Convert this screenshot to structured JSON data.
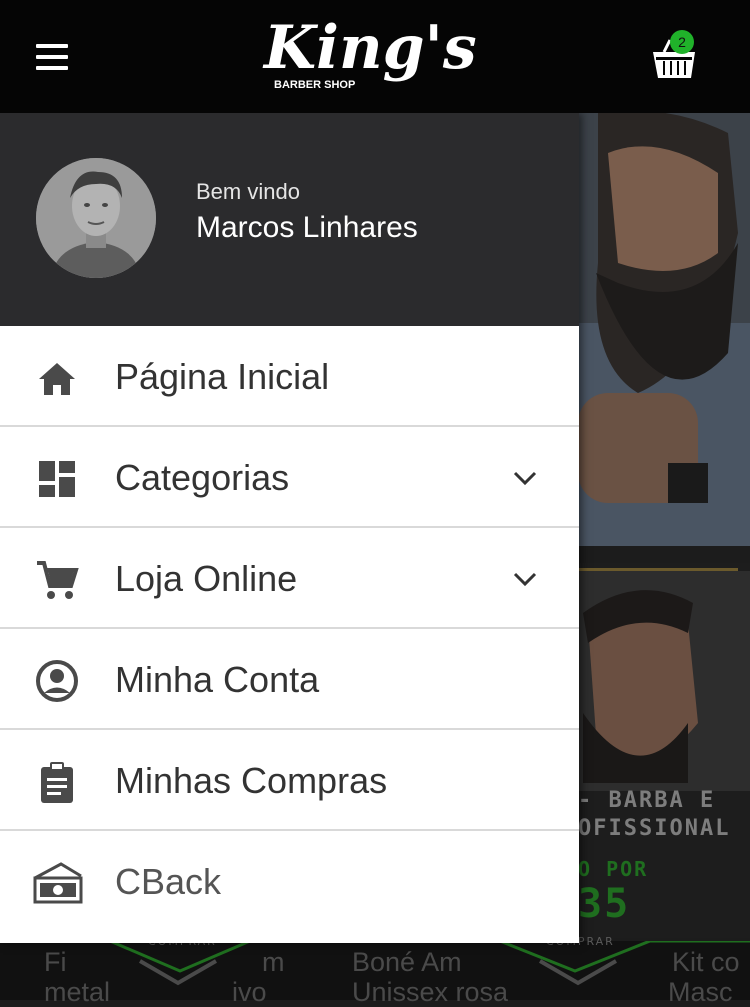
{
  "header": {
    "brand_script": "King's",
    "brand_sub": "BARBER SHOP",
    "cart_count": "2"
  },
  "drawer": {
    "greeting": "Bem vindo",
    "user_name": "Marcos Linhares",
    "items": [
      {
        "label": "Página Inicial",
        "icon": "home-icon",
        "expandable": false
      },
      {
        "label": "Categorias",
        "icon": "dashboard-icon",
        "expandable": true
      },
      {
        "label": "Loja Online",
        "icon": "shopping-cart-icon",
        "expandable": true
      },
      {
        "label": "Minha Conta",
        "icon": "account-circle-icon",
        "expandable": false
      },
      {
        "label": "Minhas Compras",
        "icon": "clipboard-icon",
        "expandable": false
      },
      {
        "label": "CBack",
        "icon": "cash-icon",
        "expandable": false
      }
    ]
  },
  "background": {
    "promo_line1": "- BARBA E",
    "promo_line2": "OFISSIONAL",
    "promo_price_label": "O POR",
    "promo_price": "35",
    "buy_label_1": "COMPRAR",
    "buy_label_2": "COMPRAR",
    "product_1_line1": "Fi",
    "product_1_line1b": "m",
    "product_1_line2": "metal",
    "product_1_line2b": "ivo",
    "product_2_line1": "Boné Am",
    "product_2_line2": "Unissex rosa",
    "product_3_line1": "Kit co",
    "product_3_line2": "Masc"
  },
  "colors": {
    "header_bg": "#050505",
    "profile_bg": "#2b2b2d",
    "badge_green": "#20b22a",
    "accent_green": "#1f8a1f"
  }
}
